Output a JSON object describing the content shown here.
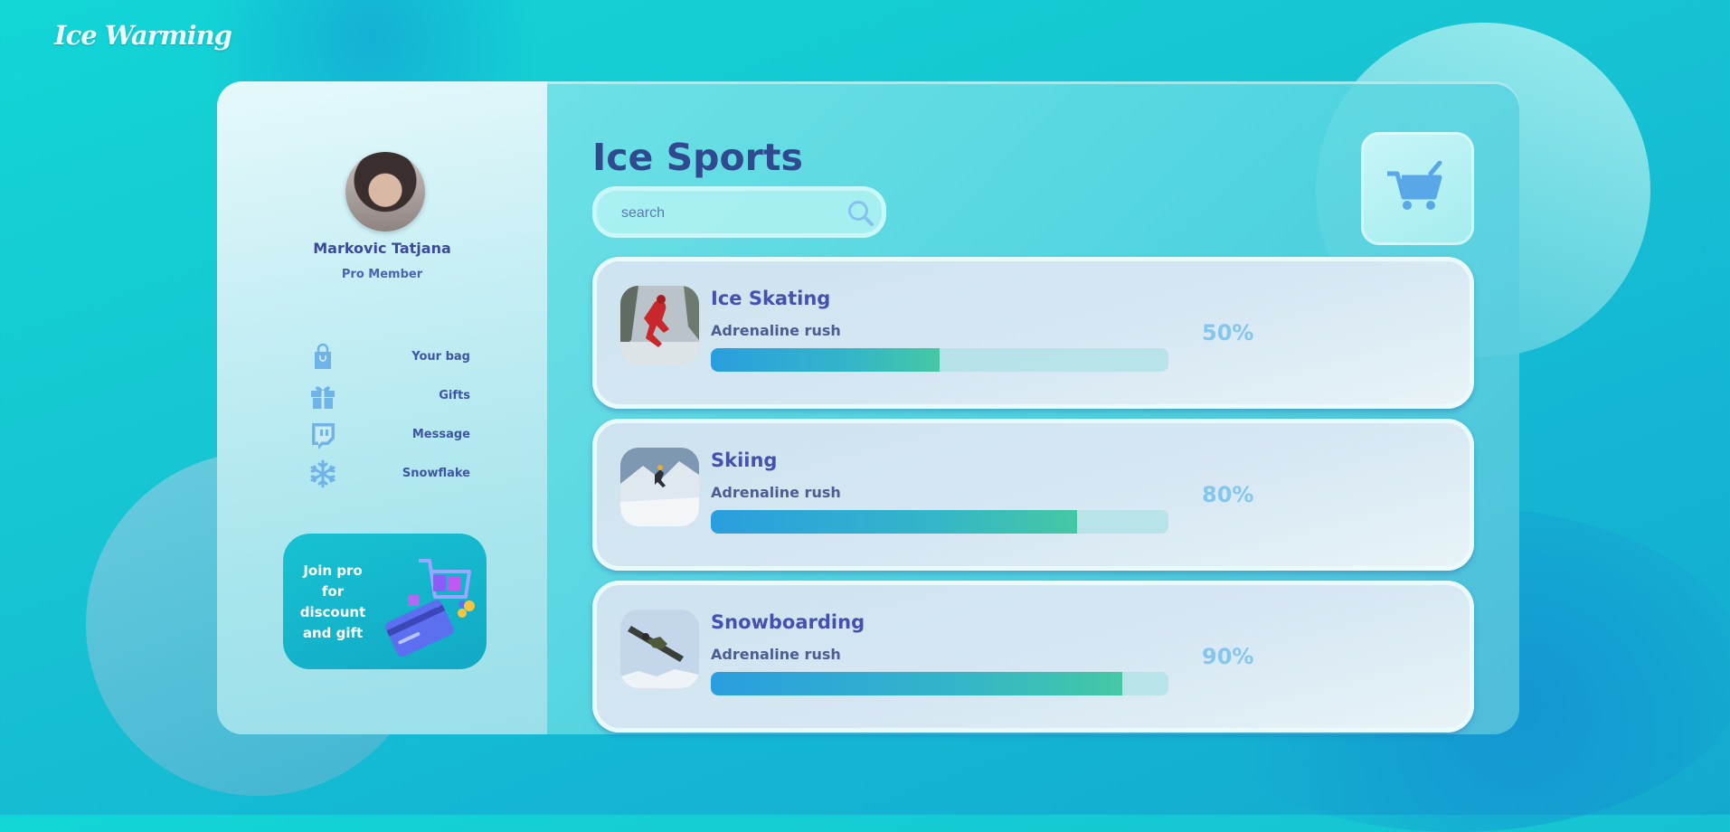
{
  "app": {
    "brand": "Ice Warming"
  },
  "user": {
    "name": "Markovic Tatjana",
    "role": "Pro Member"
  },
  "sidebar": {
    "items": [
      {
        "label": "Your bag",
        "icon": "shopping-bag-icon"
      },
      {
        "label": "Gifts",
        "icon": "gift-icon"
      },
      {
        "label": "Message",
        "icon": "twitch-message-icon"
      },
      {
        "label": "Snowflake",
        "icon": "snowflake-icon"
      }
    ],
    "promo": {
      "line1": "Join pro",
      "line2": "for",
      "line3": "discount",
      "line4": "and gift"
    }
  },
  "main": {
    "title": "Ice Sports",
    "search": {
      "placeholder": "search"
    },
    "cards": [
      {
        "title": "Ice Skating",
        "subtitle": "Adrenaline rush",
        "percent_label": "50%",
        "progress": 0.5
      },
      {
        "title": "Skiing",
        "subtitle": "Adrenaline rush",
        "percent_label": "80%",
        "progress": 0.8
      },
      {
        "title": "Snowboarding",
        "subtitle": "Adrenaline rush",
        "percent_label": "90%",
        "progress": 0.9
      }
    ]
  },
  "colors": {
    "accent": "#4650b0",
    "icon": "#6fb3e8",
    "percent": "#83c7ee"
  }
}
